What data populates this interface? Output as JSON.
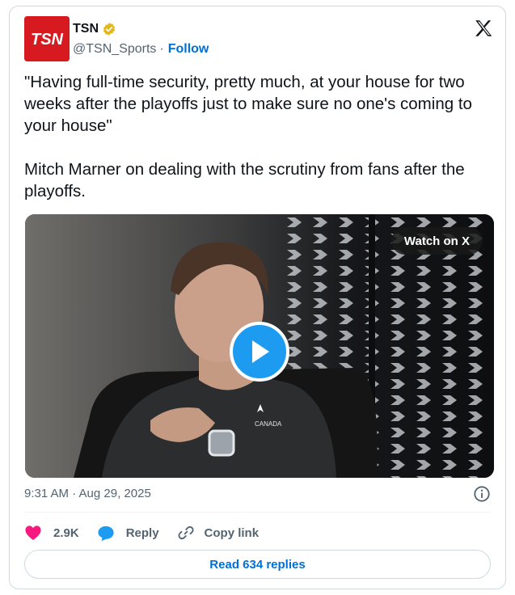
{
  "author": {
    "display_name": "TSN",
    "handle": "@TSN_Sports",
    "separator": "·",
    "follow_label": "Follow",
    "avatar_text": "TSN",
    "avatar_color": "#d71920",
    "verified_badge": "gold-check-icon"
  },
  "tweet": {
    "paragraphs": [
      "\"Having full-time security, pretty much, at your house for two weeks after the playoffs just to make sure no one's coming to your house\"",
      "Mitch Marner on dealing with the scrutiny from fans after the playoffs."
    ]
  },
  "media": {
    "watch_label": "Watch on X",
    "play_icon": "play-icon",
    "jersey_text": "CANADA"
  },
  "meta": {
    "timestamp": "9:31 AM · Aug 29, 2025"
  },
  "actions": {
    "likes": "2.9K",
    "reply_label": "Reply",
    "copy_link_label": "Copy link"
  },
  "read_replies_label": "Read 634 replies",
  "colors": {
    "link": "#006fd6",
    "like": "#f91880",
    "reply": "#1d9bf0",
    "play": "#1d9bf0",
    "muted": "#536471"
  }
}
